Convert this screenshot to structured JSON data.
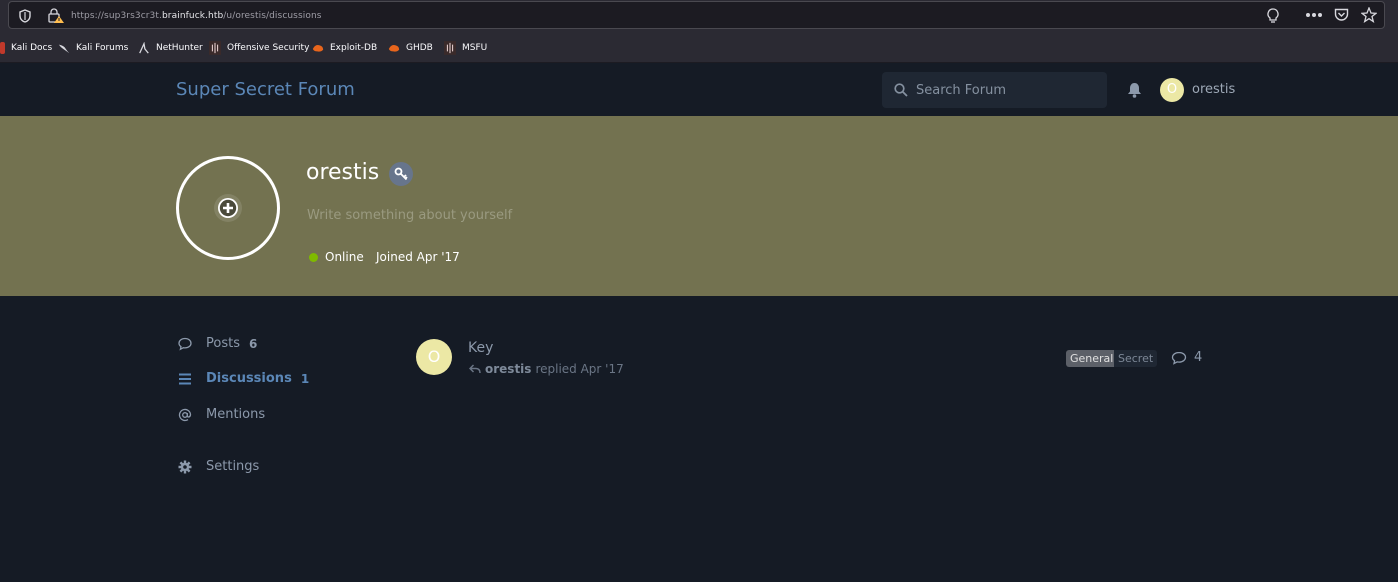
{
  "browser": {
    "url_prefix": "https://sup3rs3cr3t.",
    "url_host": "brainfuck.htb",
    "url_path": "/u/orestis/discussions",
    "bookmarks": [
      {
        "label": "Kali Docs",
        "icon": "kali-docs-icon"
      },
      {
        "label": "Kali Forums",
        "icon": "kali-dragon-icon"
      },
      {
        "label": "NetHunter",
        "icon": "nethunter-icon"
      },
      {
        "label": "Offensive Security",
        "icon": "offsec-icon"
      },
      {
        "label": "Exploit-DB",
        "icon": "exploit-db-icon"
      },
      {
        "label": "GHDB",
        "icon": "ghdb-icon"
      },
      {
        "label": "MSFU",
        "icon": "msfu-icon"
      }
    ]
  },
  "header": {
    "forum_title": "Super Secret Forum",
    "search_placeholder": "Search Forum",
    "user_initial": "O",
    "username": "orestis"
  },
  "profile": {
    "name": "orestis",
    "bio_placeholder": "Write something about yourself",
    "status": "Online",
    "joined": "Joined Apr '17",
    "colors": {
      "hero": "#737250",
      "online": "#7fba00",
      "avatar": "#ece8a5"
    }
  },
  "nav": {
    "posts_label": "Posts",
    "posts_count": "6",
    "discussions_label": "Discussions",
    "discussions_count": "1",
    "mentions_label": "Mentions",
    "settings_label": "Settings"
  },
  "discussion": {
    "avatar_initial": "O",
    "title": "Key",
    "author": "orestis",
    "action": "replied Apr '17",
    "tags": [
      "General",
      "Secret"
    ],
    "reply_count": "4"
  }
}
